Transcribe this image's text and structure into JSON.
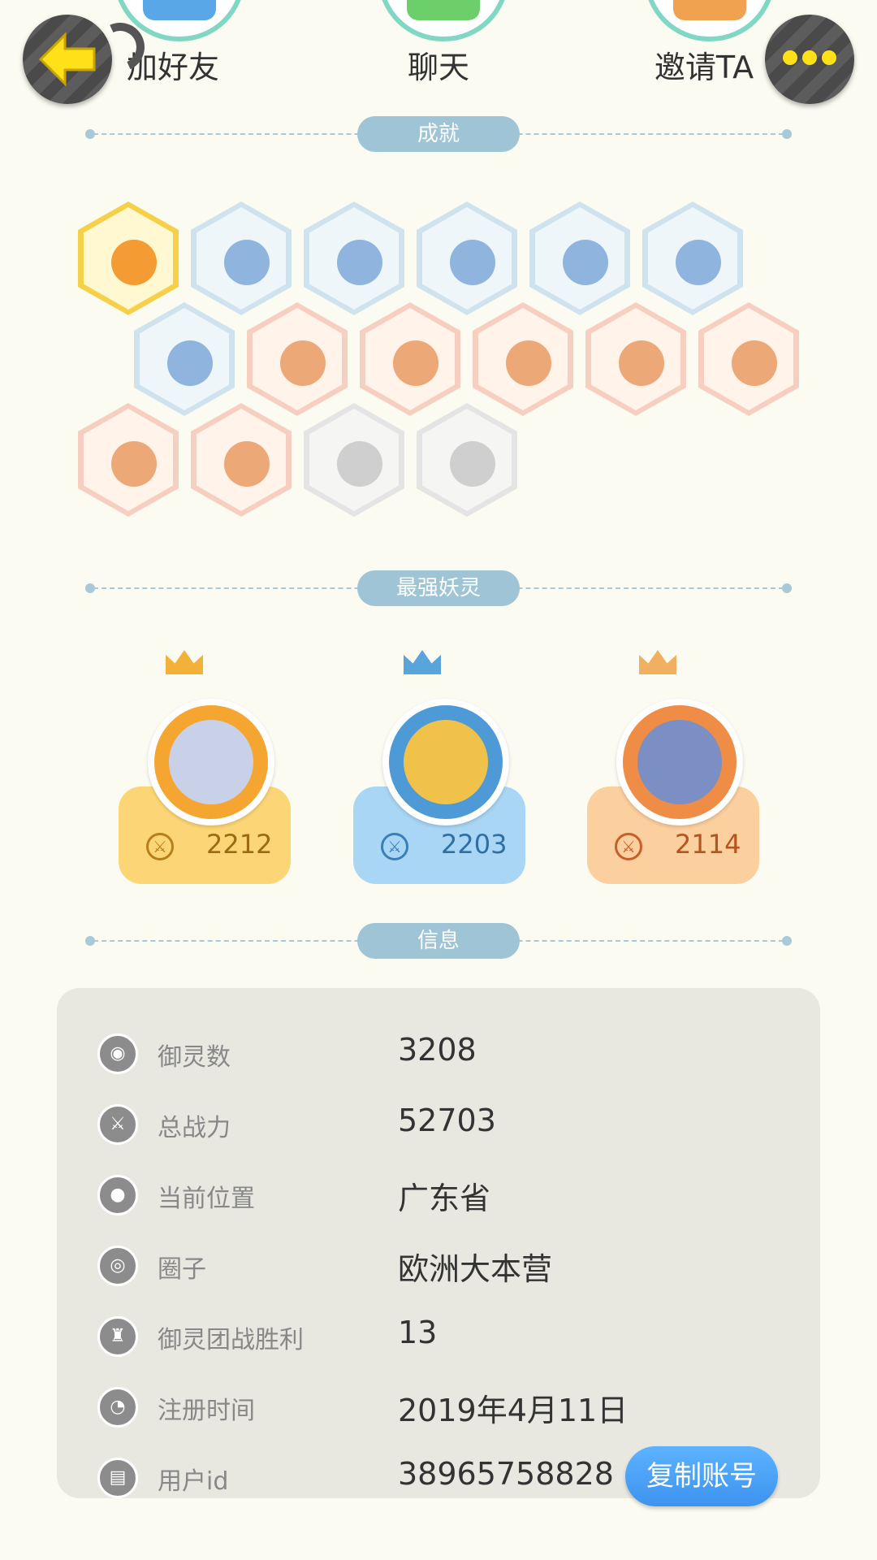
{
  "top_actions": {
    "add_friend": "加好友",
    "chat": "聊天",
    "invite": "邀请TA"
  },
  "sections": {
    "achievements": "成就",
    "strongest_spirits": "最强妖灵",
    "info": "信息"
  },
  "achievements": [
    {
      "tier": "gold"
    },
    {
      "tier": "blue"
    },
    {
      "tier": "blue"
    },
    {
      "tier": "blue"
    },
    {
      "tier": "blue"
    },
    {
      "tier": "blue"
    },
    {
      "tier": "blue"
    },
    {
      "tier": "orange"
    },
    {
      "tier": "orange"
    },
    {
      "tier": "orange"
    },
    {
      "tier": "orange"
    },
    {
      "tier": "orange"
    },
    {
      "tier": "orange"
    },
    {
      "tier": "orange"
    },
    {
      "tier": "gray"
    },
    {
      "tier": "gray"
    }
  ],
  "spirits": [
    {
      "power": "2212",
      "color": "#fcd676"
    },
    {
      "power": "2203",
      "color": "#a9d6f5"
    },
    {
      "power": "2114",
      "color": "#fbcf9e"
    }
  ],
  "info_rows": [
    {
      "label": "御灵数",
      "value": "3208",
      "icon": "spirit-count-icon"
    },
    {
      "label": "总战力",
      "value": "52703",
      "icon": "power-icon"
    },
    {
      "label": "当前位置",
      "value": "广东省",
      "icon": "location-pin-icon"
    },
    {
      "label": "圈子",
      "value": "欧洲大本营",
      "icon": "circle-target-icon"
    },
    {
      "label": "御灵团战胜利",
      "value": "13",
      "icon": "trophy-icon"
    },
    {
      "label": "注册时间",
      "value": "2019年4月11日",
      "icon": "clock-icon"
    },
    {
      "label": "用户id",
      "value": "38965758828",
      "icon": "id-card-icon"
    }
  ],
  "copy_button": "复制账号"
}
